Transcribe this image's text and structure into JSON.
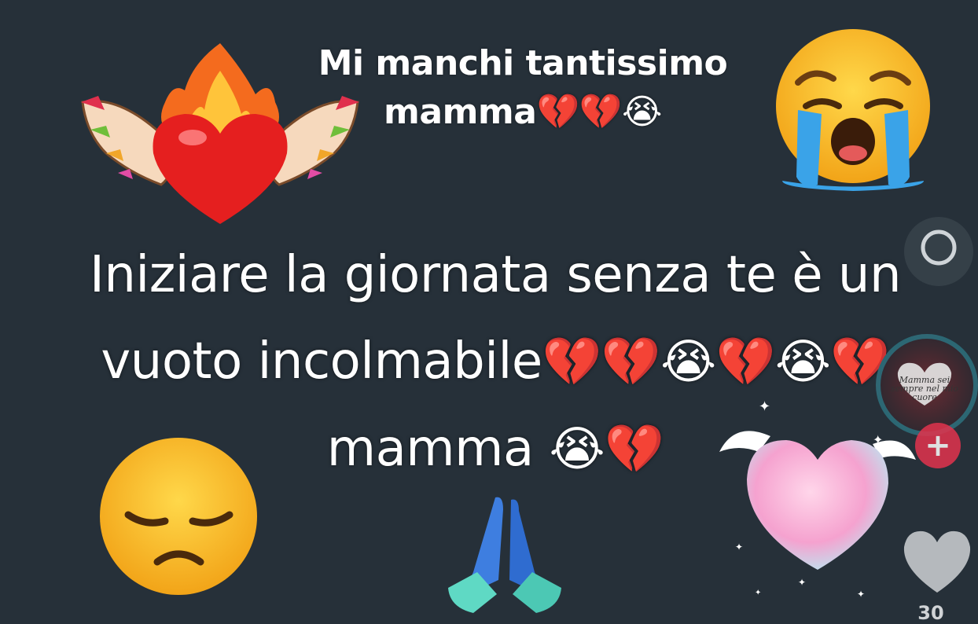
{
  "caption": {
    "line1": "Mi manchi tantissimo",
    "line2": "mamma💔💔😭"
  },
  "main_text": {
    "line1": "Iniziare la giornata senza te è un",
    "line2_text": "vuoto incolmabile",
    "line2_emojis": "💔💔😭💔😭💔",
    "line3_text": "mamma ",
    "line3_emojis": "😭💔"
  },
  "side_rail": {
    "disc_text": "Mamma sei sempre nel mio cuore",
    "follow_label": "+",
    "like_count": "30"
  },
  "colors": {
    "background": "#263039",
    "text": "#ffffff",
    "follow_accent": "#e2334d"
  },
  "icons": {
    "winged_heart": "winged-flaming-heart-icon",
    "crying_face": "loudly-crying-face-icon",
    "pensive_face": "pensive-face-icon",
    "praying_hands": "praying-hands-icon",
    "angel_heart": "winged-pink-heart-icon"
  }
}
